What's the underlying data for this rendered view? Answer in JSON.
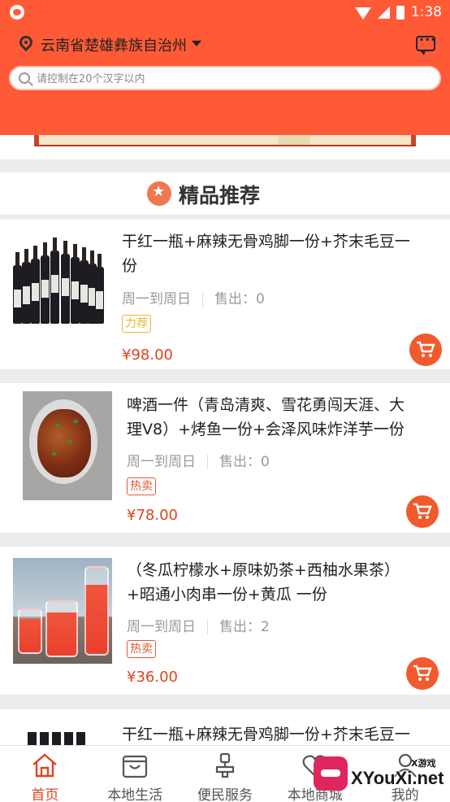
{
  "status_bar": {
    "time": "1:38"
  },
  "header": {
    "location": "云南省楚雄彝族自治州",
    "search_placeholder": "请控制在20个汉字以内"
  },
  "section": {
    "title": "精品推荐"
  },
  "products": [
    {
      "title_line1": "干红一瓶+麻辣无骨鸡脚一份+芥末毛豆一",
      "title_line2": "份",
      "schedule": "周一到周日",
      "sold": "售出：0",
      "tag": "力荐",
      "price": "¥98.00"
    },
    {
      "title_line1": "啤酒一件（青岛清爽、雪花勇闯天涯、大",
      "title_line2": "理V8）+烤鱼一份+会泽风味炸洋芋一份",
      "schedule": "周一到周日",
      "sold": "售出：0",
      "tag": "热卖",
      "price": "¥78.00"
    },
    {
      "title_line1": "（冬瓜柠檬水+原味奶茶+西柚水果茶）",
      "title_line2": "+昭通小肉串一份+黄瓜 一份",
      "schedule": "周一到周日",
      "sold": "售出：2",
      "tag": "热卖",
      "price": "¥36.00"
    },
    {
      "title_line1": "干红一瓶+麻辣无骨鸡脚一份+芥末毛豆一"
    }
  ],
  "bottom_nav": [
    {
      "label": "首页",
      "icon": "home-icon",
      "active": true
    },
    {
      "label": "本地生活",
      "icon": "bag-icon"
    },
    {
      "label": "便民服务",
      "icon": "stamp-icon"
    },
    {
      "label": "本地商城",
      "icon": "heart-shield-icon"
    },
    {
      "label": "我的",
      "icon": "user-icon"
    }
  ],
  "watermark": {
    "text": "XYouXi.net",
    "sub": "X游戏"
  },
  "colors": {
    "brand": "#ff5a36",
    "price": "#e0441f",
    "cart": "#f15a2c"
  }
}
